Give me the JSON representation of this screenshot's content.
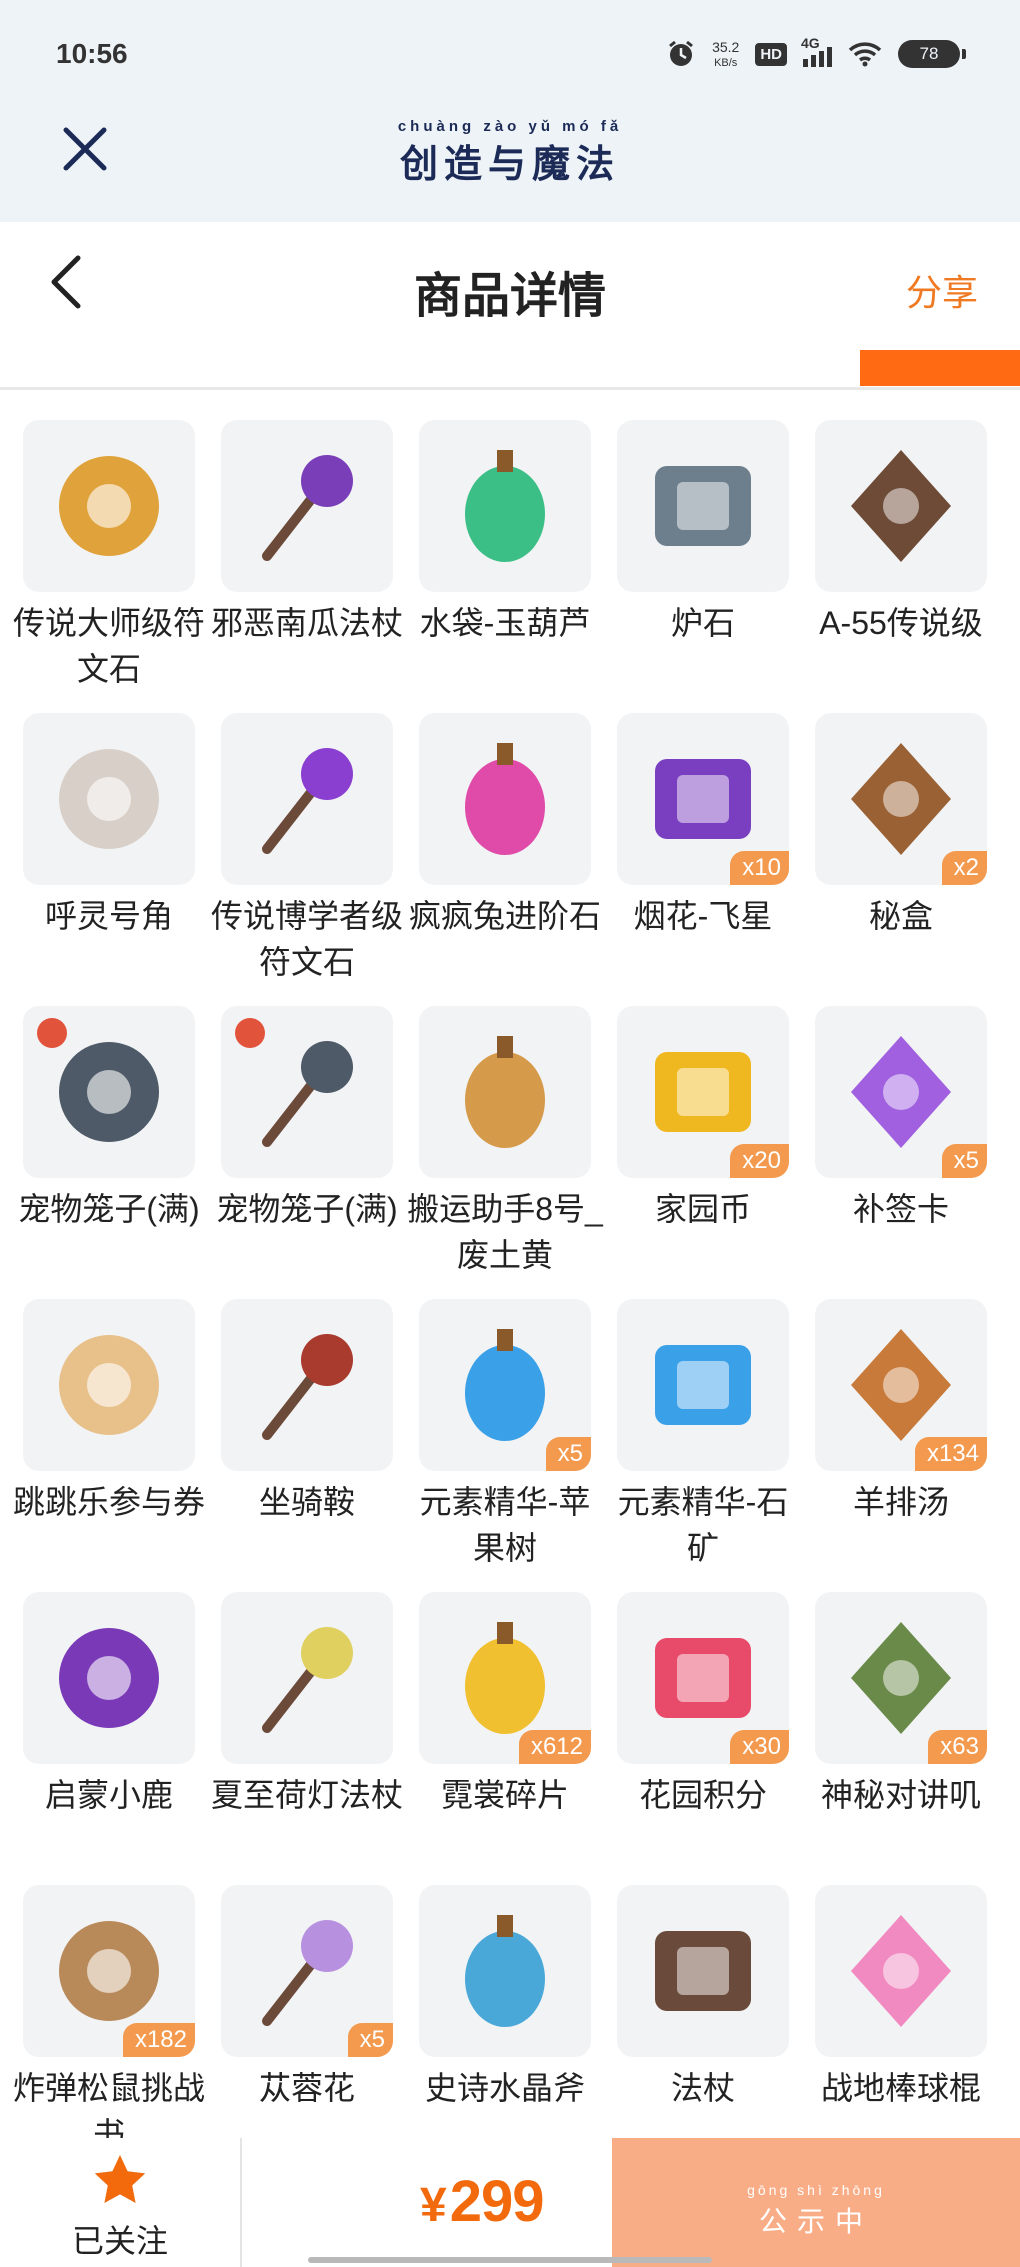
{
  "status_bar": {
    "time": "10:56",
    "net_speed_value": "35.2",
    "net_speed_unit": "KB/s",
    "hd": "HD",
    "network": "4G",
    "battery": "78"
  },
  "app": {
    "title_pinyin": "chuàng zào yǔ mó fǎ",
    "title": "创造与魔法"
  },
  "nav": {
    "page_title": "商品详情",
    "share": "分享"
  },
  "items": [
    {
      "name": "传说大师级符文石",
      "qty": "",
      "icon": "legendary-master-rune-icon",
      "color": "#e0a23a"
    },
    {
      "name": "邪恶南瓜法杖",
      "qty": "",
      "icon": "evil-pumpkin-staff-icon",
      "color": "#7a3fb8"
    },
    {
      "name": "水袋-玉葫芦",
      "qty": "",
      "icon": "jade-gourd-icon",
      "color": "#3bbf86"
    },
    {
      "name": "炉石",
      "qty": "",
      "icon": "hearthstone-icon",
      "color": "#6d7f8d"
    },
    {
      "name": "A-55传说级",
      "qty": "",
      "icon": "a55-rifle-icon",
      "color": "#6e4b36"
    },
    {
      "name": "呼灵号角",
      "qty": "",
      "icon": "spirit-horn-icon",
      "color": "#d8d0c8"
    },
    {
      "name": "传说博学者级符文石",
      "qty": "",
      "icon": "legendary-scholar-rune-icon",
      "color": "#8a3fd0"
    },
    {
      "name": "疯疯兔进阶石",
      "qty": "",
      "icon": "crazy-rabbit-stone-icon",
      "color": "#e04aa8"
    },
    {
      "name": "烟花-飞星",
      "qty": "x10",
      "icon": "firework-icon",
      "color": "#7a3fc0"
    },
    {
      "name": "秘盒",
      "qty": "x2",
      "icon": "mystery-box-icon",
      "color": "#9a6234"
    },
    {
      "name": "宠物笼子(满)",
      "qty": "",
      "icon": "pet-cage-icon",
      "color": "#4e5a68"
    },
    {
      "name": "宠物笼子(满)",
      "qty": "",
      "icon": "pet-cage-icon",
      "color": "#4e5a68"
    },
    {
      "name": "搬运助手8号_废土黄",
      "qty": "",
      "icon": "carry-robot-icon",
      "color": "#d59a4a"
    },
    {
      "name": "家园币",
      "qty": "x20",
      "icon": "home-coin-icon",
      "color": "#f0b820"
    },
    {
      "name": "补签卡",
      "qty": "x5",
      "icon": "makeup-card-icon",
      "color": "#a060e0"
    },
    {
      "name": "跳跳乐参与券",
      "qty": "",
      "icon": "jump-ticket-icon",
      "color": "#e8c08a"
    },
    {
      "name": "坐骑鞍",
      "qty": "",
      "icon": "mount-saddle-icon",
      "color": "#a83a2e"
    },
    {
      "name": "元素精华-苹果树",
      "qty": "x5",
      "icon": "apple-tree-essence-icon",
      "color": "#3aa0e8"
    },
    {
      "name": "元素精华-石矿",
      "qty": "",
      "icon": "stone-ore-essence-icon",
      "color": "#3aa0e8"
    },
    {
      "name": "羊排汤",
      "qty": "x134",
      "icon": "lamb-soup-icon",
      "color": "#c87a3a"
    },
    {
      "name": "启蒙小鹿",
      "qty": "",
      "icon": "enlightenment-deer-icon",
      "color": "#7a3ab8"
    },
    {
      "name": "夏至荷灯法杖",
      "qty": "",
      "icon": "lotus-lamp-staff-icon",
      "color": "#e0d060"
    },
    {
      "name": "霓裳碎片",
      "qty": "x612",
      "icon": "clothing-shard-icon",
      "color": "#f0c030"
    },
    {
      "name": "花园积分",
      "qty": "x30",
      "icon": "garden-points-icon",
      "color": "#e84a6a"
    },
    {
      "name": "神秘对讲叽",
      "qty": "x63",
      "icon": "mystery-walkie-talkie-icon",
      "color": "#6a8a4a"
    },
    {
      "name": "炸弹松鼠挑战书",
      "qty": "x182",
      "icon": "bomb-squirrel-challenge-icon",
      "color": "#b88a5a"
    },
    {
      "name": "苁蓉花",
      "qty": "x5",
      "icon": "cistanche-flower-icon",
      "color": "#b890e0"
    },
    {
      "name": "史诗水晶斧",
      "qty": "",
      "icon": "epic-crystal-axe-icon",
      "color": "#4aa8d8"
    },
    {
      "name": "法杖",
      "qty": "",
      "icon": "magic-staff-icon",
      "color": "#6a4a3a"
    },
    {
      "name": "战地棒球棍",
      "qty": "",
      "icon": "baseball-bat-icon",
      "color": "#f08ac0"
    }
  ],
  "bottom_bar": {
    "follow_label": "已关注",
    "currency": "¥",
    "price": "299",
    "status_pinyin": "gōng shì zhōng",
    "status_label": "公示中"
  },
  "colors": {
    "accent": "#f26a0c",
    "status_button": "#f9ad86",
    "qty_badge": "#f39a4e"
  }
}
